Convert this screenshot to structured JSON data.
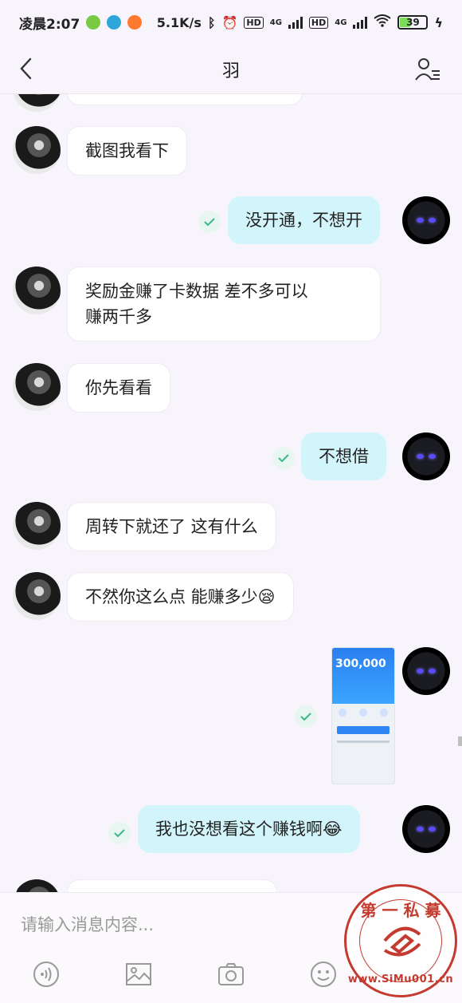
{
  "status_bar": {
    "time": "凌晨2:07",
    "speed": "5.1K/s",
    "hd1": "HD",
    "net1": "4G",
    "hd2": "HD",
    "net2": "4G",
    "battery": "39"
  },
  "header": {
    "title": "羽"
  },
  "messages": [
    {
      "side": "left",
      "text": "截图我看下"
    },
    {
      "side": "right",
      "text": "没开通，不想开"
    },
    {
      "side": "left",
      "text_line1": "奖励金赚了卡数据  差不多可以",
      "text_line2": "赚两千多"
    },
    {
      "side": "left",
      "text": "你先看看"
    },
    {
      "side": "right",
      "text": "不想借"
    },
    {
      "side": "left",
      "text": "周转下就还了 这有什么"
    },
    {
      "side": "left",
      "text": "不然你这么点 能赚多少😪"
    },
    {
      "side": "right",
      "type": "image",
      "amount": "300,000"
    },
    {
      "side": "right",
      "text": "我也没想看这个赚钱啊😂"
    }
  ],
  "input": {
    "placeholder": "请输入消息内容..."
  },
  "toolbar": {
    "voice_icon": "voice-icon",
    "image_icon": "image-icon",
    "camera_icon": "camera-icon",
    "emoji_icon": "emoji-icon"
  },
  "watermark": {
    "top": "第 一 私 募",
    "bottom": "www.SiMu001.cn"
  },
  "colors": {
    "background": "#f8f4fb",
    "right_bubble": "#d2f5fb",
    "left_bubble": "#ffffff",
    "seal": "#c43a2f"
  }
}
